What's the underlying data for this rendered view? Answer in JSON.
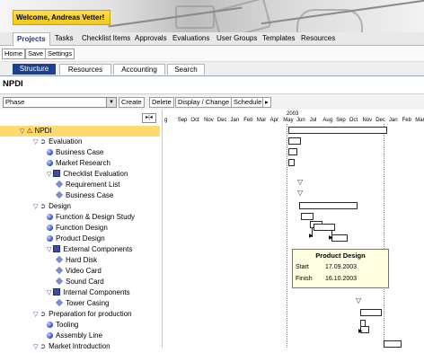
{
  "header": {
    "welcome": "Welcome, Andreas Vetter!"
  },
  "main_menu": [
    "Projects",
    "Tasks",
    "Checklist Items",
    "Approvals",
    "Evaluations",
    "User Groups",
    "Templates",
    "Resources"
  ],
  "sub_menu": [
    "Home",
    "Save",
    "Settings"
  ],
  "tabs": [
    "Structure",
    "Resources",
    "Accounting",
    "Search"
  ],
  "page_title": "NPDI",
  "toolbar": {
    "view_select": "Phase",
    "buttons": [
      "Create",
      "Delete",
      "Display / Change",
      "Schedule",
      "▸"
    ]
  },
  "gantt": {
    "year": "2003",
    "months": [
      "g",
      "Sep",
      "Oct",
      "Nov",
      "Dec",
      "Jan",
      "Feb",
      "Mar",
      "Apr",
      "May",
      "Jun",
      "Jul",
      "Aug",
      "Sep",
      "Oct",
      "Nov",
      "Dec",
      "Jan",
      "Feb",
      "Mar"
    ]
  },
  "tree": [
    {
      "label": "NPDI",
      "type": "warn",
      "level": 0,
      "selected": true
    },
    {
      "label": "Evaluation",
      "type": "phase",
      "level": 1
    },
    {
      "label": "Business Case",
      "type": "task",
      "level": 2
    },
    {
      "label": "Market Research",
      "type": "task",
      "level": 2
    },
    {
      "label": "Checklist Evaluation",
      "type": "checklist",
      "level": 2
    },
    {
      "label": "Requirement List",
      "type": "item",
      "level": 3
    },
    {
      "label": "Business Case",
      "type": "item",
      "level": 3
    },
    {
      "label": "Design",
      "type": "phase",
      "level": 1
    },
    {
      "label": "Function & Design Study",
      "type": "task",
      "level": 2
    },
    {
      "label": "Function Design",
      "type": "task",
      "level": 2
    },
    {
      "label": "Product Design",
      "type": "task",
      "level": 2
    },
    {
      "label": "External Components",
      "type": "checklist",
      "level": 2
    },
    {
      "label": "Hard Disk",
      "type": "item",
      "level": 3
    },
    {
      "label": "Video Card",
      "type": "item",
      "level": 3
    },
    {
      "label": "Sound Card",
      "type": "item",
      "level": 3
    },
    {
      "label": "Internal Components",
      "type": "checklist",
      "level": 2
    },
    {
      "label": "Tower Casing",
      "type": "item",
      "level": 3
    },
    {
      "label": "Preparation for production",
      "type": "phase",
      "level": 1
    },
    {
      "label": "Tooling",
      "type": "task",
      "level": 2
    },
    {
      "label": "Assembly Line",
      "type": "task",
      "level": 2
    },
    {
      "label": "Market Introduction",
      "type": "phase",
      "level": 1
    }
  ],
  "tooltip": {
    "title": "Product Design",
    "start_label": "Start",
    "start_value": "17.09.2003",
    "finish_label": "Finish",
    "finish_value": "16.10.2003"
  }
}
